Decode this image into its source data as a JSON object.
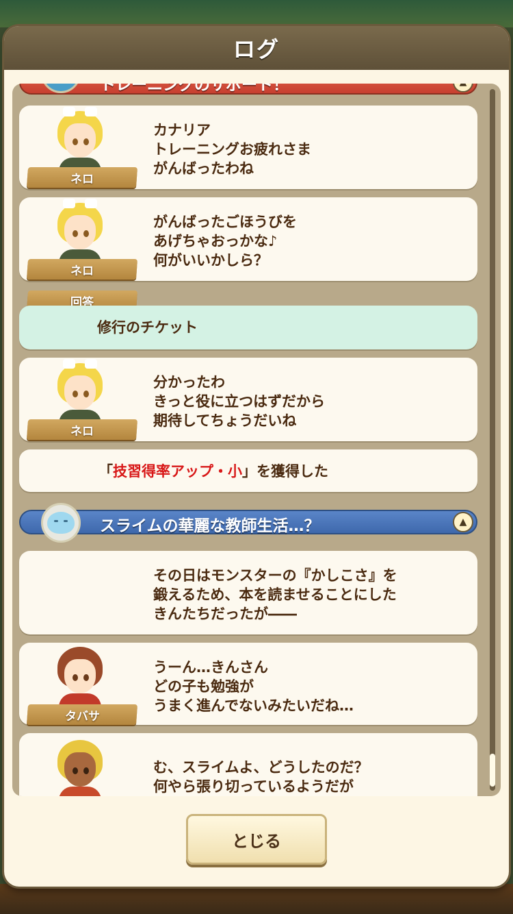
{
  "dialog": {
    "title": "ログ",
    "close_label": "とじる"
  },
  "sections": [
    {
      "title": "トレーニングのサポート！",
      "color": "#d9533e",
      "toggle": "up-triangle-icon"
    },
    {
      "title": "スライムの華麗な教師生活…？",
      "color": "#4a76ba",
      "toggle": "up-triangle-icon"
    }
  ],
  "log": [
    {
      "speaker": "ネロ",
      "lines": [
        "カナリア",
        "トレーニングお疲れさま",
        "がんばったわね"
      ]
    },
    {
      "speaker": "ネロ",
      "lines": [
        "がんばったごほうびを",
        "あげちゃおっかな♪",
        "何がいいかしら？"
      ]
    },
    {
      "answer_label": "回答",
      "answer": "修行のチケット"
    },
    {
      "speaker": "ネロ",
      "lines": [
        "分かったわ",
        "きっと役に立つはずだから",
        "期待してちょうだいね"
      ]
    },
    {
      "acquired_prefix": "「",
      "acquired_item": "技習得率アップ・小",
      "acquired_suffix": "」を獲得した"
    },
    {
      "narration": [
        "その日はモンスターの『かしこさ』を",
        "鍛えるため、本を読ませることにした",
        "きんたちだったが――"
      ]
    },
    {
      "speaker": "タバサ",
      "lines": [
        "うーん…きんさん",
        "どの子も勉強が",
        "うまく進んでないみたいだね…"
      ]
    },
    {
      "speaker": "",
      "lines": [
        "む、スライムよ、どうしたのだ？",
        "何やら張り切っているようだが"
      ]
    }
  ],
  "colors": {
    "highlight": "#d81818",
    "answer_bg": "#d4f2e4",
    "header_bg": "#6e5e42"
  }
}
